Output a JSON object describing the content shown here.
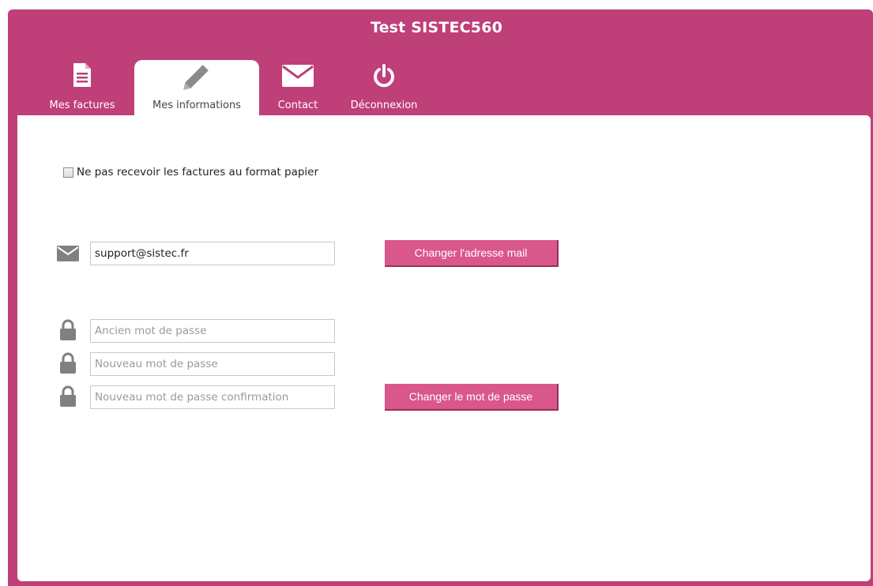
{
  "app": {
    "title": "Test SISTEC560"
  },
  "tabs": [
    {
      "label": "Mes factures",
      "icon": "document-icon"
    },
    {
      "label": "Mes informations",
      "icon": "pencil-icon",
      "active": true
    },
    {
      "label": "Contact",
      "icon": "envelope-icon"
    },
    {
      "label": "Déconnexion",
      "icon": "power-icon"
    }
  ],
  "form": {
    "paper_checkbox": {
      "label": "Ne pas recevoir les factures au format papier",
      "checked": false
    },
    "email": {
      "value": "support@sistec.fr",
      "button_label": "Changer l'adresse mail",
      "icon": "envelope-icon"
    },
    "password": {
      "old_placeholder": "Ancien mot de passe",
      "new_placeholder": "Nouveau mot de passe",
      "confirm_placeholder": "Nouveau mot de passe confirmation",
      "button_label": "Changer le mot de passe",
      "icon": "lock-icon"
    }
  },
  "colors": {
    "brand": "#bf3f78",
    "button": "#d9578a",
    "icon_gray": "#808080"
  }
}
